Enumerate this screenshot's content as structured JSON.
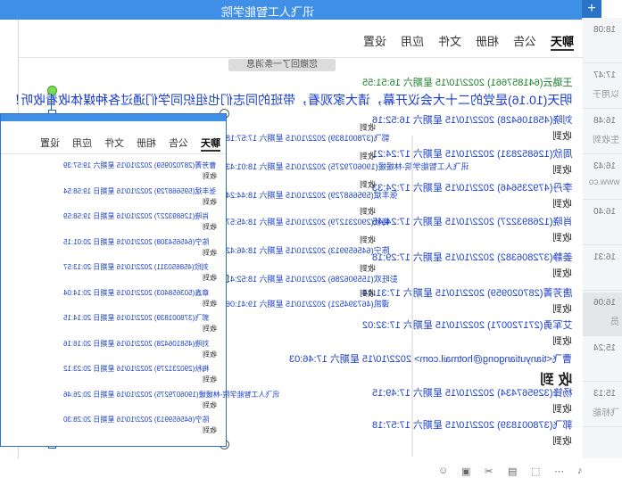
{
  "header": {
    "title": "讯飞人工智能学院"
  },
  "plus_label": "+",
  "tabs": [
    {
      "label": "聊天",
      "active": true
    },
    {
      "label": "公告",
      "active": false
    },
    {
      "label": "相册",
      "active": false
    },
    {
      "label": "文件",
      "active": false
    },
    {
      "label": "应用",
      "active": false
    },
    {
      "label": "设置",
      "active": false
    }
  ],
  "system_notice": "您撤回了一条消息",
  "messages": [
    {
      "header": "王璐云(641857661) 2022/10/15 星期六 16:51:55",
      "body": "明天(10.16)是党的二十大会议开幕，请大家观看，带班的同志们也组织同学们通过各种媒体收看收听！",
      "green": true
    },
    {
      "header": "刘晓(458106428) 2022/10/15 星期六 16:52:16",
      "body": "收到"
    },
    {
      "header": "周欣(126852831) 2022/10/15 星期六 17:24:21",
      "body": "收到"
    },
    {
      "header": "李丹(479235646) 2022/10/15 星期六 17:24:33",
      "body": "收到"
    },
    {
      "header": "肖晓(126893227) 2022/10/15 星期六 17:24:45",
      "body": "收到"
    },
    {
      "header": "姜静(372806382) 2022/10/15 星期六 17:29:18",
      "body": "收到"
    },
    {
      "header": "唐芳菁(287020959) 2022/10/15 星期六 17:31:44",
      "body": "收到"
    },
    {
      "header": "艾军勇(271720071) 2022/10/15 星期六 17:32:02",
      "body": "收到"
    },
    {
      "header": "曹飞<tianyutiangong@hotmail.com> 2022/10/15 星期六 17:46:03",
      "body": "收 到"
    },
    {
      "header": "杨锋(329567434) 2022/10/15 星期六 17:49:15",
      "body": "收到"
    },
    {
      "header": "郭飞(378001839) 2022/10/15 星期六 17:57:18",
      "body": "收到"
    }
  ],
  "middle_messages": [
    {
      "header": "郭飞(378001839) 2022/10/15 星期六 17:57:18",
      "body": "收到"
    },
    {
      "header": "讯飞人工智能学院-林媛媛(1906079275) 2022/10/15 星期六 18:01:43",
      "body": "收到"
    },
    {
      "header": "张丰斌(595668729) 2022/10/15 星期六 18:44:24",
      "body": "收到"
    },
    {
      "header": "梅秋(290231279) 2022/10/15 星期六 18:45:57",
      "body": "收到"
    },
    {
      "header": "陈宁(645659913) 2022/10/15 星期六 18:46:42",
      "body": "收到"
    },
    {
      "header": "彭旺欢(155906286) 2022/10/15 星期六 18:52:41",
      "body": "收到"
    },
    {
      "header": "谭凯(467394521) 2022/10/15 星期六 19:41:06",
      "body": "收到"
    }
  ],
  "overlay": {
    "tabs": [
      {
        "label": "聊天",
        "active": true
      },
      {
        "label": "公告",
        "active": false
      },
      {
        "label": "相册",
        "active": false
      },
      {
        "label": "文件",
        "active": false
      },
      {
        "label": "应用",
        "active": false
      },
      {
        "label": "设置",
        "active": false
      }
    ],
    "messages": [
      {
        "header": "曹芳菁(287020959) 2022/10/15 星期六 19:57:39",
        "body": "收到"
      },
      {
        "header": "张丰斌(595668729) 2022/10/16 星期日 19:58:54",
        "body": "收到"
      },
      {
        "header": "肖晓(126893227) 2022/10/16 星期日 19:58:59",
        "body": "收到"
      },
      {
        "header": "陈宁(645654308) 2022/10/16 星期日 20:01:15",
        "body": "收到"
      },
      {
        "header": "刘欣(458650311) 2022/10/16 星期日 20:13:57",
        "body": "收到"
      },
      {
        "header": "章鑫(503658403) 2022/10/16 星期日 20:14:04",
        "body": "收到"
      },
      {
        "header": "郭飞(378001839) 2022/10/16 星期日 20:14:15",
        "body": "收到"
      },
      {
        "header": "刘晓(458106428) 2022/10/16 星期日 20:16:16",
        "body": "收到"
      },
      {
        "header": "梅秋(290231279) 2022/10/16 星期日 20:23:12",
        "body": "收到"
      },
      {
        "header": "讯飞人工智能学院-林媛媛(1906079275) 2022/10/16 星期日 20:26:46",
        "body": "收到"
      },
      {
        "header": "陈宁(645659913) 2022/10/16 星期日 20:28:30",
        "body": "收到"
      }
    ]
  },
  "conversations": [
    {
      "time": "18:08",
      "snippet": "",
      "selected": false
    },
    {
      "time": "17:47",
      "snippet": "以用于",
      "selected": false
    },
    {
      "time": "16:48",
      "snippet": "生收到",
      "selected": false
    },
    {
      "time": "16:43",
      "snippet": "www.co",
      "selected": false
    },
    {
      "time": "16:40",
      "snippet": "",
      "selected": false
    },
    {
      "time": "16:31",
      "snippet": "",
      "selected": false
    },
    {
      "time": "16:06",
      "snippet": "员",
      "selected": true
    },
    {
      "time": "15:24",
      "snippet": "",
      "selected": false
    },
    {
      "time": "15:13",
      "snippet": "飞标能",
      "selected": false
    }
  ],
  "bottom_icons": [
    "smile-icon",
    "image-icon",
    "scissors-icon",
    "folder-icon",
    "screenshot-icon",
    "more-icon",
    "voice-icon"
  ]
}
